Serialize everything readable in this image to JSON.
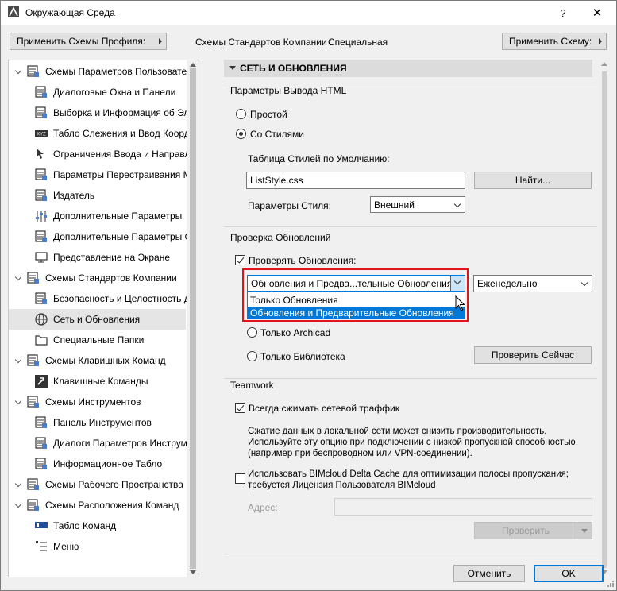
{
  "window": {
    "title": "Окружающая Среда",
    "help_glyph": "?",
    "close_glyph": "✕"
  },
  "toolbar": {
    "apply_profile_label": "Применить Схемы Профиля:",
    "company_schemes_label": "Схемы Стандартов Компании :",
    "company_schemes_value": "Специальная",
    "apply_scheme_label": "Применить Схему:"
  },
  "tree": {
    "items": [
      {
        "label": "Схемы Параметров Пользователя",
        "icon": "user-settings-icon",
        "level": 0
      },
      {
        "label": "Диалоговые Окна и Панели",
        "icon": "dialog-icon",
        "level": 1
      },
      {
        "label": "Выборка и Информация об Эле",
        "icon": "selection-icon",
        "level": 1
      },
      {
        "label": "Табло Слежения и Ввод Коорди",
        "icon": "xyz-icon",
        "level": 1
      },
      {
        "label": "Ограничения Ввода и Направля",
        "icon": "cursor-icon",
        "level": 1
      },
      {
        "label": "Параметры Перестраивания Мо",
        "icon": "rebuild-icon",
        "level": 1
      },
      {
        "label": "Издатель",
        "icon": "publisher-icon",
        "level": 1
      },
      {
        "label": "Дополнительные Параметры",
        "icon": "sliders-icon",
        "level": 1
      },
      {
        "label": "Дополнительные Параметры О",
        "icon": "home-settings-icon",
        "level": 1
      },
      {
        "label": "Представление на Экране",
        "icon": "monitor-icon",
        "level": 1
      },
      {
        "label": "Схемы Стандартов Компании",
        "icon": "company-icon",
        "level": 0
      },
      {
        "label": "Безопасность и Целостность да",
        "icon": "security-icon",
        "level": 1
      },
      {
        "label": "Сеть и Обновления",
        "icon": "globe-icon",
        "level": 1
      },
      {
        "label": "Специальные Папки",
        "icon": "folder-icon",
        "level": 1
      },
      {
        "label": "Схемы Клавишных Команд",
        "icon": "keyboard-scheme-icon",
        "level": 0
      },
      {
        "label": "Клавишные Команды",
        "icon": "shortcut-icon",
        "level": 1
      },
      {
        "label": "Схемы Инструментов",
        "icon": "tools-scheme-icon",
        "level": 0
      },
      {
        "label": "Панель Инструментов",
        "icon": "toolbar-icon",
        "level": 1
      },
      {
        "label": "Диалоги Параметров Инструме",
        "icon": "tool-dialog-icon",
        "level": 1
      },
      {
        "label": "Информационное Табло",
        "icon": "info-board-icon",
        "level": 1
      },
      {
        "label": "Схемы Рабочего Пространства",
        "icon": "workspace-icon",
        "level": 0
      },
      {
        "label": "Схемы Расположения Команд",
        "icon": "command-layout-icon",
        "level": 0
      },
      {
        "label": "Табло Команд",
        "icon": "command-board-icon",
        "level": 1
      },
      {
        "label": "Меню",
        "icon": "menu-icon",
        "level": 1
      }
    ],
    "selected_index": 12
  },
  "section": {
    "title": "СЕТЬ И ОБНОВЛЕНИЯ"
  },
  "html_output": {
    "group_title": "Параметры Вывода HTML",
    "radio_simple": "Простой",
    "radio_styles": "Со Стилями",
    "selected": "styles",
    "stylesheet_label": "Таблица Стилей по Умолчанию:",
    "stylesheet_value": "ListStyle.css",
    "find_button": "Найти...",
    "style_params_label": "Параметры Стиля:",
    "style_params_value": "Внешний"
  },
  "updates": {
    "group_title": "Проверка Обновлений",
    "check_label": "Проверять Обновления:",
    "checked": true,
    "type_value": "Обновления и Предва...тельные Обновления",
    "type_options": [
      "Только Обновления",
      "Обновления и Предварительные Обновления"
    ],
    "type_selected_index": 1,
    "frequency_value": "Еженедельно",
    "radio_archicad": "Только Archicad",
    "radio_library": "Только Библиотека",
    "check_now_button": "Проверить Сейчас"
  },
  "teamwork": {
    "group_title": "Teamwork",
    "compress_label": "Всегда сжимать сетевой траффик",
    "compress_checked": true,
    "compress_note": [
      "Сжатие данных в локальной сети может снизить производительность.",
      "Используйте эту опцию при подключении с низкой пропускной способностью",
      "(например при беспроводном или VPN-соединении)."
    ],
    "delta_label_line1": "Использовать BIMcloud Delta Cache  для оптимизации полосы пропускания;",
    "delta_label_line2": "требуется Лицензия Пользователя BIMcloud",
    "delta_checked": false,
    "address_label": "Адрес:",
    "address_value": "",
    "verify_button": "Проверить"
  },
  "footer": {
    "cancel": "Отменить",
    "ok": "OK"
  },
  "colors": {
    "accent": "#0078d7",
    "highlight_border": "#e0151b",
    "selection_bg": "#e5e5e5"
  }
}
